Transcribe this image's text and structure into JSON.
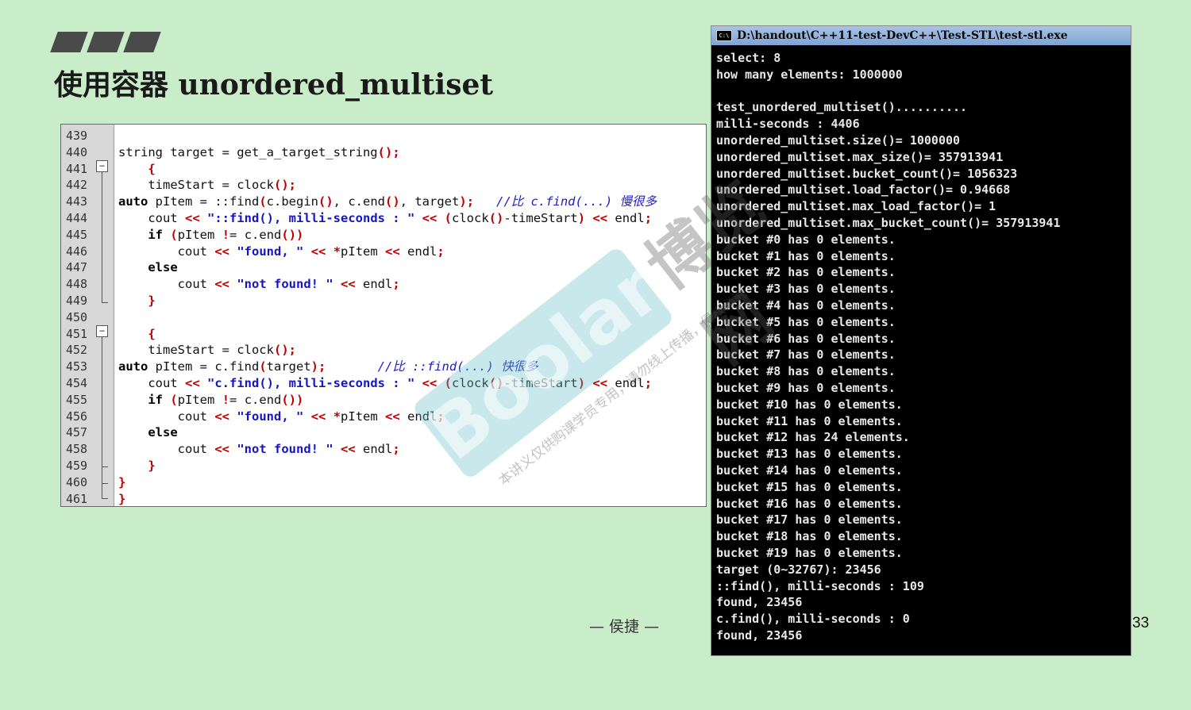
{
  "slide": {
    "title": "使用容器 unordered_multiset",
    "footer": "— 侯捷 —",
    "page_number": "33"
  },
  "editor": {
    "lines": [
      {
        "no": "439",
        "code": ""
      },
      {
        "no": "440",
        "code": "string target = get_a_target_string();"
      },
      {
        "no": "441",
        "code": "    {"
      },
      {
        "no": "442",
        "code": "    timeStart = clock();"
      },
      {
        "no": "443",
        "code": "auto pItem = ::find(c.begin(), c.end(), target);   //比 c.find(...) 慢很多"
      },
      {
        "no": "444",
        "code": "    cout << \"::find(), milli-seconds : \" << (clock()-timeStart) << endl;"
      },
      {
        "no": "445",
        "code": "    if (pItem != c.end())"
      },
      {
        "no": "446",
        "code": "        cout << \"found, \" << *pItem << endl;"
      },
      {
        "no": "447",
        "code": "    else"
      },
      {
        "no": "448",
        "code": "        cout << \"not found! \" << endl;"
      },
      {
        "no": "449",
        "code": "    }"
      },
      {
        "no": "450",
        "code": ""
      },
      {
        "no": "451",
        "code": "    {"
      },
      {
        "no": "452",
        "code": "    timeStart = clock();"
      },
      {
        "no": "453",
        "code": "auto pItem = c.find(target);       //比 ::find(...) 快很多"
      },
      {
        "no": "454",
        "code": "    cout << \"c.find(), milli-seconds : \" << (clock()-timeStart) << endl;"
      },
      {
        "no": "455",
        "code": "    if (pItem != c.end())"
      },
      {
        "no": "456",
        "code": "        cout << \"found, \" << *pItem << endl;"
      },
      {
        "no": "457",
        "code": "    else"
      },
      {
        "no": "458",
        "code": "        cout << \"not found! \" << endl;"
      },
      {
        "no": "459",
        "code": "    }"
      },
      {
        "no": "460",
        "code": "}"
      },
      {
        "no": "461",
        "code": "}"
      }
    ]
  },
  "console": {
    "title": "D:\\handout\\C++11-test-DevC++\\Test-STL\\test-stl.exe",
    "icon": "console-app-icon",
    "lines": [
      "select: 8",
      "how many elements: 1000000",
      "",
      "test_unordered_multiset()..........",
      "milli-seconds : 4406",
      "unordered_multiset.size()= 1000000",
      "unordered_multiset.max_size()= 357913941",
      "unordered_multiset.bucket_count()= 1056323",
      "unordered_multiset.load_factor()= 0.94668",
      "unordered_multiset.max_load_factor()= 1",
      "unordered_multiset.max_bucket_count()= 357913941",
      "bucket #0 has 0 elements.",
      "bucket #1 has 0 elements.",
      "bucket #2 has 0 elements.",
      "bucket #3 has 0 elements.",
      "bucket #4 has 0 elements.",
      "bucket #5 has 0 elements.",
      "bucket #6 has 0 elements.",
      "bucket #7 has 0 elements.",
      "bucket #8 has 0 elements.",
      "bucket #9 has 0 elements.",
      "bucket #10 has 0 elements.",
      "bucket #11 has 0 elements.",
      "bucket #12 has 24 elements.",
      "bucket #13 has 0 elements.",
      "bucket #14 has 0 elements.",
      "bucket #15 has 0 elements.",
      "bucket #16 has 0 elements.",
      "bucket #17 has 0 elements.",
      "bucket #18 has 0 elements.",
      "bucket #19 has 0 elements.",
      "target (0~32767): 23456",
      "::find(), milli-seconds : 109",
      "found, 23456",
      "c.find(), milli-seconds : 0",
      "found, 23456"
    ]
  },
  "watermark": {
    "brand": "Boolan",
    "cn": "博览网",
    "notice": "本讲义仅供购课学员专用，请勿线上传播，侵权必究"
  },
  "colors": {
    "background": "#c9ecc9",
    "console_bg": "#000000",
    "console_text": "#e8e8e8",
    "code_string": "#1515c8",
    "code_operator": "#c00000"
  }
}
